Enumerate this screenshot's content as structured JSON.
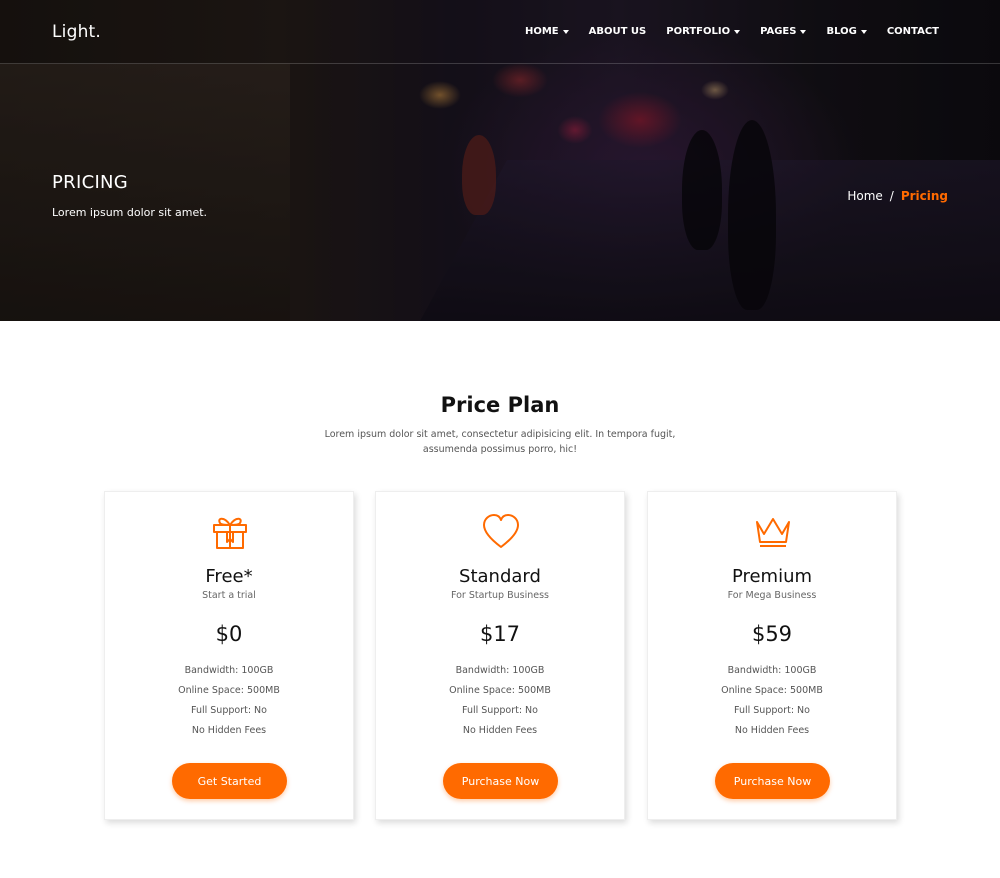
{
  "brand": "Light.",
  "nav": {
    "items": [
      {
        "label": "HOME",
        "dropdown": true
      },
      {
        "label": "ABOUT US",
        "dropdown": false
      },
      {
        "label": "PORTFOLIO",
        "dropdown": true
      },
      {
        "label": "PAGES",
        "dropdown": true
      },
      {
        "label": "BLOG",
        "dropdown": true
      },
      {
        "label": "CONTACT",
        "dropdown": false
      }
    ]
  },
  "hero": {
    "title": "PRICING",
    "subtitle": "Lorem ipsum dolor sit amet.",
    "breadcrumb": {
      "home": "Home",
      "separator": "/",
      "current": "Pricing"
    }
  },
  "section": {
    "title": "Price Plan",
    "description": "Lorem ipsum dolor sit amet, consectetur adipisicing elit. In tempora fugit, assumenda possimus porro, hic!"
  },
  "plans": [
    {
      "icon": "gift-icon",
      "name": "Free*",
      "tagline": "Start a trial",
      "price": "$0",
      "features": [
        "Bandwidth: 100GB",
        "Online Space: 500MB",
        "Full Support: No",
        "No Hidden Fees"
      ],
      "button": "Get Started"
    },
    {
      "icon": "heart-icon",
      "name": "Standard",
      "tagline": "For Startup Business",
      "price": "$17",
      "features": [
        "Bandwidth: 100GB",
        "Online Space: 500MB",
        "Full Support: No",
        "No Hidden Fees"
      ],
      "button": "Purchase Now"
    },
    {
      "icon": "crown-icon",
      "name": "Premium",
      "tagline": "For Mega Business",
      "price": "$59",
      "features": [
        "Bandwidth: 100GB",
        "Online Space: 500MB",
        "Full Support: No",
        "No Hidden Fees"
      ],
      "button": "Purchase Now"
    }
  ],
  "colors": {
    "accent": "#ff6a00",
    "heading": "#111111",
    "body_text": "#555555"
  }
}
